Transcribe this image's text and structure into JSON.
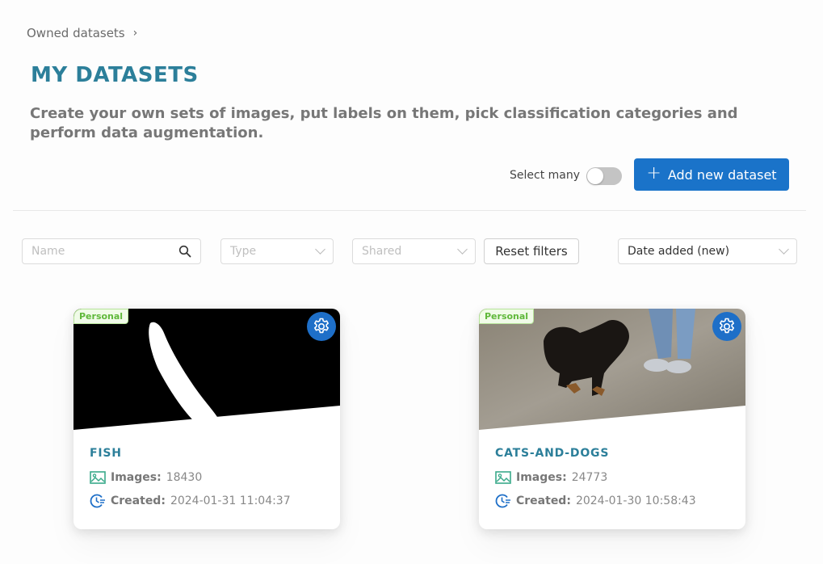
{
  "breadcrumb": {
    "items": [
      "Owned datasets"
    ],
    "separator_icon": "chevron-right-icon"
  },
  "header": {
    "title": "MY DATASETS",
    "subtitle": "Create your own sets of images, put labels on them, pick classification categories and perform data augmentation."
  },
  "actions": {
    "select_many_label": "Select many",
    "select_many_enabled": false,
    "add_button_label": "Add new dataset",
    "add_button_icon": "plus-icon"
  },
  "filters": {
    "name_placeholder": "Name",
    "type_placeholder": "Type",
    "shared_placeholder": "Shared",
    "reset_label": "Reset filters",
    "sort_value": "Date added (new)"
  },
  "colors": {
    "accent": "#1a73c9",
    "title": "#2c7f9a",
    "badge": "#5fb83a"
  },
  "datasets": [
    {
      "badge": "Personal",
      "name": "FISH",
      "images_label": "Images:",
      "images_count": "18430",
      "created_label": "Created:",
      "created_at": "2024-01-31 11:04:37"
    },
    {
      "badge": "Personal",
      "name": "CATS-AND-DOGS",
      "images_label": "Images:",
      "images_count": "24773",
      "created_label": "Created:",
      "created_at": "2024-01-30 10:58:43"
    }
  ]
}
